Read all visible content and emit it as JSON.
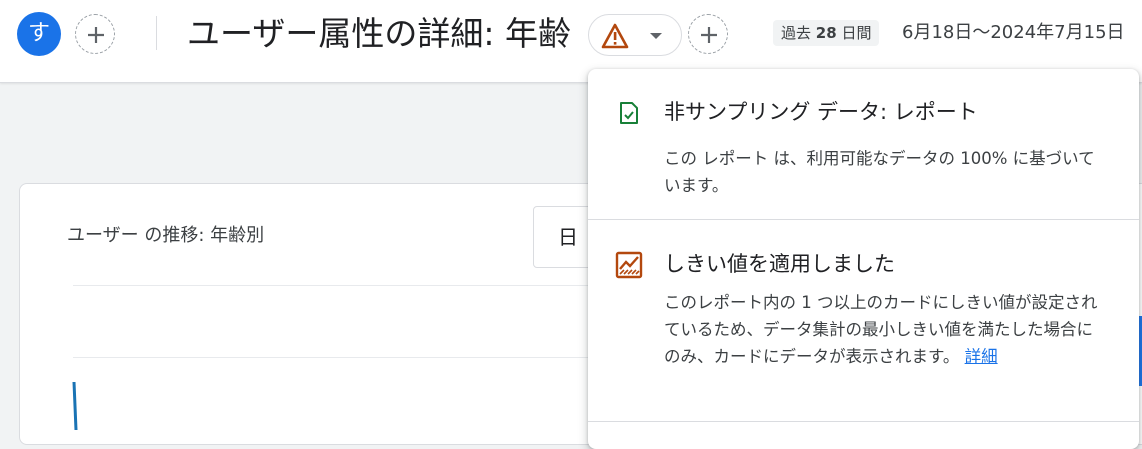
{
  "header": {
    "avatar_letter": "す",
    "title": "ユーザー属性の詳細: 年齢",
    "range_prefix": "過去",
    "range_days": "28",
    "range_suffix": "日間",
    "date_range": "6月18日～2024年7月15日"
  },
  "card": {
    "title": "ユーザー の推移: 年齢別",
    "select_value": "日"
  },
  "popup": {
    "items": [
      {
        "icon": "doc-check-icon",
        "title": "非サンプリング データ: レポート",
        "description": "この レポート は、利用可能なデータの 100% に基づいています。"
      },
      {
        "icon": "threshold-chart-icon",
        "title": "しきい値を適用しました",
        "description": "このレポート内の 1 つ以上のカードにしきい値が設定されているため、データ集計の最小しきい値を満たした場合にのみ、カードにデータが表示されます。",
        "link_text": "詳細"
      }
    ]
  },
  "colors": {
    "accent_blue": "#1a73e8",
    "warning_orange": "#b3480e",
    "success_green": "#188038",
    "chart_line": "#1a73b4"
  }
}
